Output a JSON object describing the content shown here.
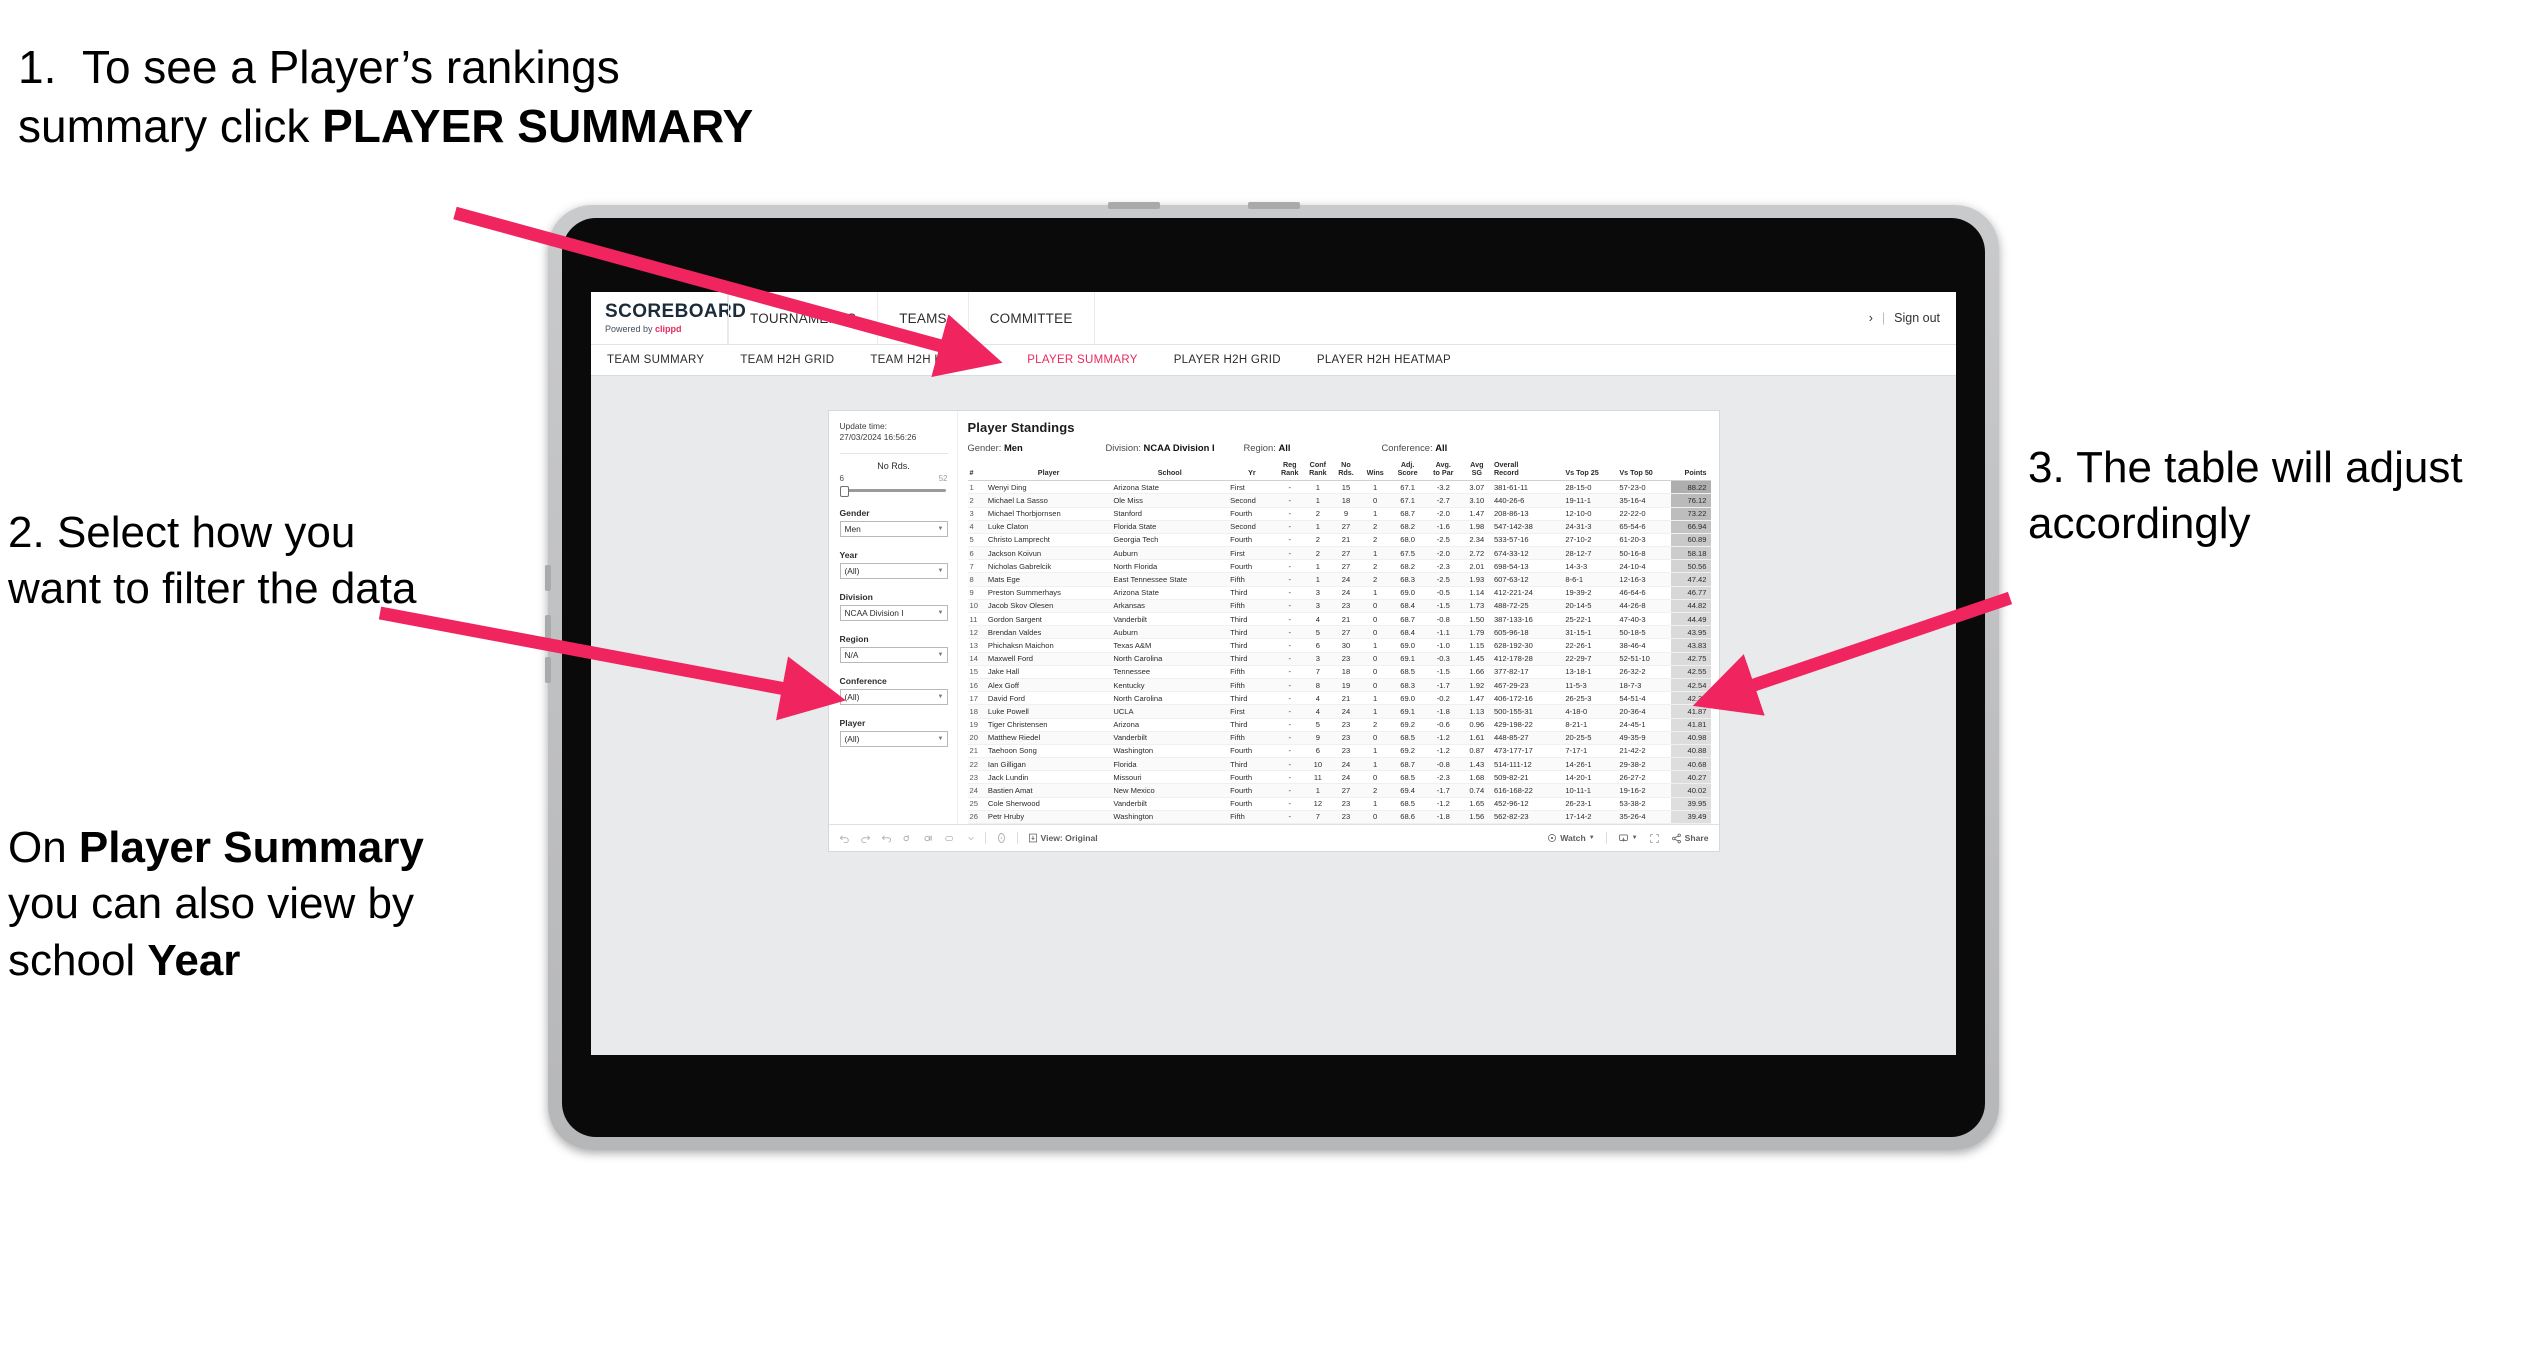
{
  "annotations": {
    "step1": {
      "number": "1.",
      "text_before": "To see a Player’s rankings summary click ",
      "bold": "PLAYER SUMMARY"
    },
    "step2": {
      "number": "2.",
      "text": "Select how you want to filter the data"
    },
    "step2b": {
      "pre": "On ",
      "bold1": "Player Summary",
      "mid": " you can also view by school ",
      "bold2": "Year"
    },
    "step3": {
      "number": "3.",
      "text": "The table will adjust accordingly"
    },
    "arrow_color": "#f0245f"
  },
  "app": {
    "logo": {
      "title": "SCOREBOARD",
      "powered_prefix": "Powered by ",
      "brand": "clippd"
    },
    "top_nav": [
      "TOURNAMENTS",
      "TEAMS",
      "COMMITTEE"
    ],
    "account": {
      "chevron": "›",
      "separator": "|",
      "sign_out": "Sign out"
    },
    "sub_nav": [
      {
        "label": "TEAM SUMMARY",
        "active": false
      },
      {
        "label": "TEAM H2H GRID",
        "active": false
      },
      {
        "label": "TEAM H2H HEATMAP",
        "active": false
      },
      {
        "label": "PLAYER SUMMARY",
        "active": true
      },
      {
        "label": "PLAYER H2H GRID",
        "active": false
      },
      {
        "label": "PLAYER H2H HEATMAP",
        "active": false
      }
    ],
    "accent_color": "#e8295c"
  },
  "filters": {
    "update_time_label": "Update time:",
    "update_time_value": "27/03/2024 16:56:26",
    "slider": {
      "title": "No Rds.",
      "min": "6",
      "max": "52"
    },
    "selects": [
      {
        "label": "Gender",
        "value": "Men"
      },
      {
        "label": "Year",
        "value": "(All)"
      },
      {
        "label": "Division",
        "value": "NCAA Division I"
      },
      {
        "label": "Region",
        "value": "N/A"
      },
      {
        "label": "Conference",
        "value": "(All)"
      },
      {
        "label": "Player",
        "value": "(All)"
      }
    ]
  },
  "table": {
    "title": "Player Standings",
    "meta": [
      {
        "label": "Gender:",
        "value": "Men"
      },
      {
        "label": "Division:",
        "value": "NCAA Division I"
      },
      {
        "label": "Region:",
        "value": "All"
      },
      {
        "label": "Conference:",
        "value": "All"
      }
    ],
    "columns": [
      "#",
      "Player",
      "School",
      "Yr",
      "Reg\nRank",
      "Conf\nRank",
      "No\nRds.",
      "Wins",
      "Adj.\nScore",
      "Avg.\nto Par",
      "Avg\nSG",
      "Overall\nRecord",
      "Vs Top 25",
      "Vs Top 50",
      "Points"
    ],
    "rows": [
      [
        "1",
        "Wenyi Ding",
        "Arizona State",
        "First",
        "-",
        "1",
        "15",
        "1",
        "67.1",
        "-3.2",
        "3.07",
        "381-61-11",
        "28-15-0",
        "57-23-0",
        "88.22"
      ],
      [
        "2",
        "Michael La Sasso",
        "Ole Miss",
        "Second",
        "-",
        "1",
        "18",
        "0",
        "67.1",
        "-2.7",
        "3.10",
        "440-26-6",
        "19-11-1",
        "35-16-4",
        "76.12"
      ],
      [
        "3",
        "Michael Thorbjornsen",
        "Stanford",
        "Fourth",
        "-",
        "2",
        "9",
        "1",
        "68.7",
        "-2.0",
        "1.47",
        "208-86-13",
        "12-10-0",
        "22-22-0",
        "73.22"
      ],
      [
        "4",
        "Luke Claton",
        "Florida State",
        "Second",
        "-",
        "1",
        "27",
        "2",
        "68.2",
        "-1.6",
        "1.98",
        "547-142-38",
        "24-31-3",
        "65-54-6",
        "66.94"
      ],
      [
        "5",
        "Christo Lamprecht",
        "Georgia Tech",
        "Fourth",
        "-",
        "2",
        "21",
        "2",
        "68.0",
        "-2.5",
        "2.34",
        "533-57-16",
        "27-10-2",
        "61-20-3",
        "60.89"
      ],
      [
        "6",
        "Jackson Koivun",
        "Auburn",
        "First",
        "-",
        "2",
        "27",
        "1",
        "67.5",
        "-2.0",
        "2.72",
        "674-33-12",
        "28-12-7",
        "50-16-8",
        "58.18"
      ],
      [
        "7",
        "Nicholas Gabrelcik",
        "North Florida",
        "Fourth",
        "-",
        "1",
        "27",
        "2",
        "68.2",
        "-2.3",
        "2.01",
        "698-54-13",
        "14-3-3",
        "24-10-4",
        "50.56"
      ],
      [
        "8",
        "Mats Ege",
        "East Tennessee State",
        "Fifth",
        "-",
        "1",
        "24",
        "2",
        "68.3",
        "-2.5",
        "1.93",
        "607-63-12",
        "8-6-1",
        "12-16-3",
        "47.42"
      ],
      [
        "9",
        "Preston Summerhays",
        "Arizona State",
        "Third",
        "-",
        "3",
        "24",
        "1",
        "69.0",
        "-0.5",
        "1.14",
        "412-221-24",
        "19-39-2",
        "46-64-6",
        "46.77"
      ],
      [
        "10",
        "Jacob Skov Olesen",
        "Arkansas",
        "Fifth",
        "-",
        "3",
        "23",
        "0",
        "68.4",
        "-1.5",
        "1.73",
        "488-72-25",
        "20-14-5",
        "44-26-8",
        "44.82"
      ],
      [
        "11",
        "Gordon Sargent",
        "Vanderbilt",
        "Third",
        "-",
        "4",
        "21",
        "0",
        "68.7",
        "-0.8",
        "1.50",
        "387-133-16",
        "25-22-1",
        "47-40-3",
        "44.49"
      ],
      [
        "12",
        "Brendan Valdes",
        "Auburn",
        "Third",
        "-",
        "5",
        "27",
        "0",
        "68.4",
        "-1.1",
        "1.79",
        "605-96-18",
        "31-15-1",
        "50-18-5",
        "43.95"
      ],
      [
        "13",
        "Phichaksn Maichon",
        "Texas A&M",
        "Third",
        "-",
        "6",
        "30",
        "1",
        "69.0",
        "-1.0",
        "1.15",
        "628-192-30",
        "22-26-1",
        "38-46-4",
        "43.83"
      ],
      [
        "14",
        "Maxwell Ford",
        "North Carolina",
        "Third",
        "-",
        "3",
        "23",
        "0",
        "69.1",
        "-0.3",
        "1.45",
        "412-178-28",
        "22-29-7",
        "52-51-10",
        "42.75"
      ],
      [
        "15",
        "Jake Hall",
        "Tennessee",
        "Fifth",
        "-",
        "7",
        "18",
        "0",
        "68.5",
        "-1.5",
        "1.66",
        "377-82-17",
        "13-18-1",
        "26-32-2",
        "42.55"
      ],
      [
        "16",
        "Alex Goff",
        "Kentucky",
        "Fifth",
        "-",
        "8",
        "19",
        "0",
        "68.3",
        "-1.7",
        "1.92",
        "467-29-23",
        "11-5-3",
        "18-7-3",
        "42.54"
      ],
      [
        "17",
        "David Ford",
        "North Carolina",
        "Third",
        "-",
        "4",
        "21",
        "1",
        "69.0",
        "-0.2",
        "1.47",
        "406-172-16",
        "26-25-3",
        "54-51-4",
        "42.35"
      ],
      [
        "18",
        "Luke Powell",
        "UCLA",
        "First",
        "-",
        "4",
        "24",
        "1",
        "69.1",
        "-1.8",
        "1.13",
        "500-155-31",
        "4-18-0",
        "20-36-4",
        "41.87"
      ],
      [
        "19",
        "Tiger Christensen",
        "Arizona",
        "Third",
        "-",
        "5",
        "23",
        "2",
        "69.2",
        "-0.6",
        "0.96",
        "429-198-22",
        "8-21-1",
        "24-45-1",
        "41.81"
      ],
      [
        "20",
        "Matthew Riedel",
        "Vanderbilt",
        "Fifth",
        "-",
        "9",
        "23",
        "0",
        "68.5",
        "-1.2",
        "1.61",
        "448-85-27",
        "20-25-5",
        "49-35-9",
        "40.98"
      ],
      [
        "21",
        "Taehoon Song",
        "Washington",
        "Fourth",
        "-",
        "6",
        "23",
        "1",
        "69.2",
        "-1.2",
        "0.87",
        "473-177-17",
        "7-17-1",
        "21-42-2",
        "40.88"
      ],
      [
        "22",
        "Ian Gilligan",
        "Florida",
        "Third",
        "-",
        "10",
        "24",
        "1",
        "68.7",
        "-0.8",
        "1.43",
        "514-111-12",
        "14-26-1",
        "29-38-2",
        "40.68"
      ],
      [
        "23",
        "Jack Lundin",
        "Missouri",
        "Fourth",
        "-",
        "11",
        "24",
        "0",
        "68.5",
        "-2.3",
        "1.68",
        "509-82-21",
        "14-20-1",
        "26-27-2",
        "40.27"
      ],
      [
        "24",
        "Bastien Amat",
        "New Mexico",
        "Fourth",
        "-",
        "1",
        "27",
        "2",
        "69.4",
        "-1.7",
        "0.74",
        "616-168-22",
        "10-11-1",
        "19-16-2",
        "40.02"
      ],
      [
        "25",
        "Cole Sherwood",
        "Vanderbilt",
        "Fourth",
        "-",
        "12",
        "23",
        "1",
        "68.5",
        "-1.2",
        "1.65",
        "452-96-12",
        "26-23-1",
        "53-38-2",
        "39.95"
      ],
      [
        "26",
        "Petr Hruby",
        "Washington",
        "Fifth",
        "-",
        "7",
        "23",
        "0",
        "68.6",
        "-1.8",
        "1.56",
        "562-82-23",
        "17-14-2",
        "35-26-4",
        "39.49"
      ]
    ]
  },
  "viz_toolbar": {
    "left_icons": [
      "undo-icon",
      "redo-icon",
      "revert-icon",
      "refresh-icon",
      "pause-icon",
      "alerts-icon",
      "dropdown-caret-icon",
      "device-preview-icon"
    ],
    "view_label": "View: Original",
    "watch_label": "Watch",
    "share_label": "Share"
  }
}
